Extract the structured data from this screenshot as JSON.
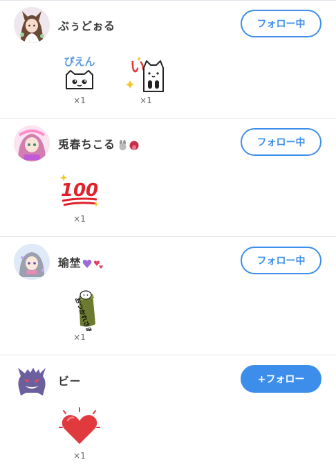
{
  "colors": {
    "accent": "#3d8eea",
    "separator": "#e3e3ea",
    "count_text": "#666666"
  },
  "users": [
    {
      "name": "ぶぅどぉる",
      "avatar_icon": "avatar-girl-brown-hair",
      "follow_label": "フォロー中",
      "following": true,
      "stamps": [
        {
          "icon": "cat-pien-stamp",
          "text": "ぴえん",
          "count": "×1"
        },
        {
          "icon": "cat-i-stamp",
          "text": "い",
          "count": "×1"
        }
      ]
    },
    {
      "name": "兎春ちこる",
      "avatar_icon": "avatar-pink-hair-girl",
      "name_icons": [
        "rabbit-emoji",
        "tongue-emoji"
      ],
      "follow_label": "フォロー中",
      "following": true,
      "stamps": [
        {
          "icon": "hundred-points-stamp",
          "text": "100",
          "count": "×1"
        }
      ]
    },
    {
      "name": "瑜埜",
      "avatar_icon": "avatar-gray-hair-girl",
      "name_icons": [
        "purple-heart-emoji",
        "hearts-emoji"
      ],
      "follow_label": "フォロー中",
      "following": true,
      "stamps": [
        {
          "icon": "otsukaresama-stamp",
          "text": "おつかれさま",
          "count": "×1"
        }
      ]
    },
    {
      "name": "ビー",
      "avatar_icon": "gengar-avatar",
      "follow_label": "+フォロー",
      "following": false,
      "stamps": [
        {
          "icon": "red-heart-stamp",
          "count": "×1"
        }
      ]
    }
  ]
}
